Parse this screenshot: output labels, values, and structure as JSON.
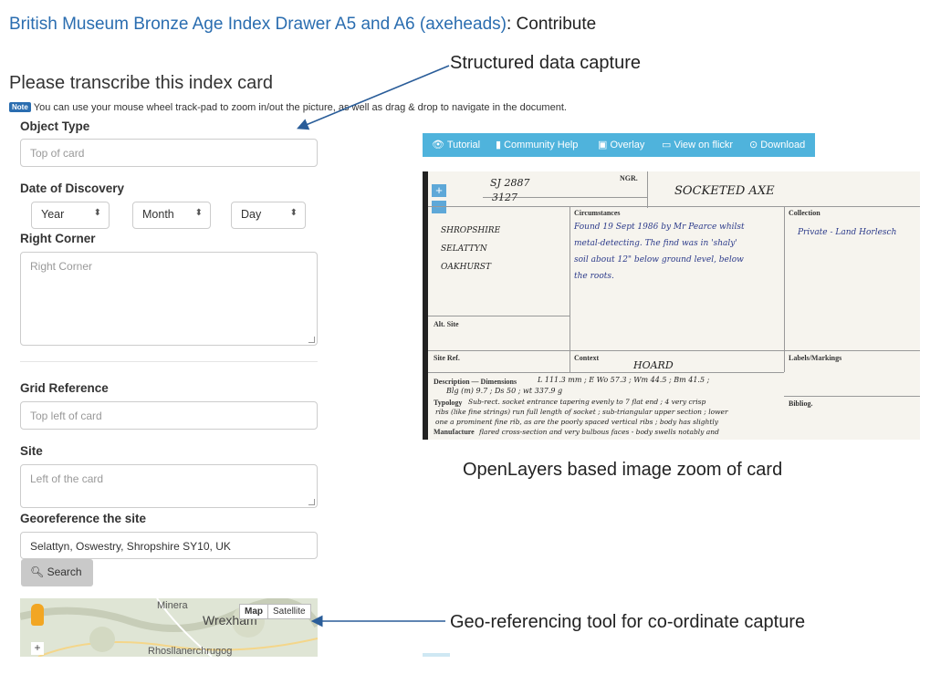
{
  "header": {
    "project_link": "British Museum Bronze Age Index Drawer A5 and A6 (axeheads)",
    "suffix": ": Contribute"
  },
  "task_title": "Please transcribe this index card",
  "note": {
    "badge": "Note",
    "text": "You can use your mouse wheel track-pad to zoom in/out the picture, as well as drag & drop to navigate in the document."
  },
  "form": {
    "object_type": {
      "label": "Object Type",
      "placeholder": "Top of card"
    },
    "date_of_discovery": {
      "label": "Date of Discovery",
      "year": "Year",
      "month": "Month",
      "day": "Day"
    },
    "right_corner": {
      "label": "Right Corner",
      "placeholder": "Right Corner"
    },
    "grid_reference": {
      "label": "Grid Reference",
      "placeholder": "Top left of card"
    },
    "site": {
      "label": "Site",
      "placeholder": "Left of the card"
    },
    "georeference": {
      "label": "Georeference the site",
      "value": "Selattyn, Oswestry, Shropshire SY10, UK"
    },
    "search_button": "Search"
  },
  "map": {
    "labels": {
      "minera": "Minera",
      "wrexham": "Wrexham",
      "rhos": "Rhosllanerchrugog"
    },
    "map_button": "Map",
    "satellite_button": "Satellite",
    "zoom_in": "+"
  },
  "toolbar": {
    "tutorial": "Tutorial",
    "community_help": "Community Help",
    "overlay": "Overlay",
    "view_on_flickr": "View on flickr",
    "download": "Download"
  },
  "card": {
    "zoom_in": "+",
    "zoom_out": "−",
    "grid_ref_1": "SJ 2887",
    "grid_ref_2": "3127",
    "ngr": "NGR.",
    "object": "SOCKETED AXE",
    "circumstances_label": "Circumstances",
    "circumstances_text": [
      "Found 19 Sept 1986 by Mr Pearce whilst",
      "metal-detecting. The find was in 'shaly'",
      "soil about 12\" below ground level, below",
      "the roots."
    ],
    "collection_label": "Collection",
    "collection_text": "Private - Land Horlesch",
    "site_lines": [
      "SHROPSHIRE",
      "SELATTYN",
      "OAKHURST"
    ],
    "alt_site_label": "Alt. Site",
    "site_ref_label": "Site Ref.",
    "context_label": "Context",
    "context_text": "HOARD",
    "labels_markings_label": "Labels/Markings",
    "bibliog_label": "Bibliog.",
    "description_label": "Description — Dimensions",
    "description_text": "L 111.3 mm ; E Wo 57.3 ; Wm 44.5 ; Bm 41.5 ;",
    "description_text_2": "Blg (m) 9.7 ; Ds 50 ; wt 337.9 g",
    "typology_label": "Typology",
    "typology_text": "Sub-rect. socket entrance tapering evenly to 7 flat end ; 4 very crisp",
    "typology_text_2": "ribs (like fine strings) run full length of socket ; sub-triangular upper section ; lower",
    "typology_text_3": "one a prominent fine rib, as are the poorly spaced vertical ribs ; body has slightly",
    "manufacture_label": "Manufacture",
    "manufacture_text": "flared cross-section and very bulbous faces - body swells notably and"
  },
  "annotations": {
    "structured": "Structured data capture",
    "openlayers": "OpenLayers based image zoom of card",
    "geo": "Geo-referencing tool for co-ordinate capture"
  },
  "colors": {
    "link": "#2a6db0",
    "toolbar": "#4fb3dc",
    "ink": "#2b3a8a"
  }
}
